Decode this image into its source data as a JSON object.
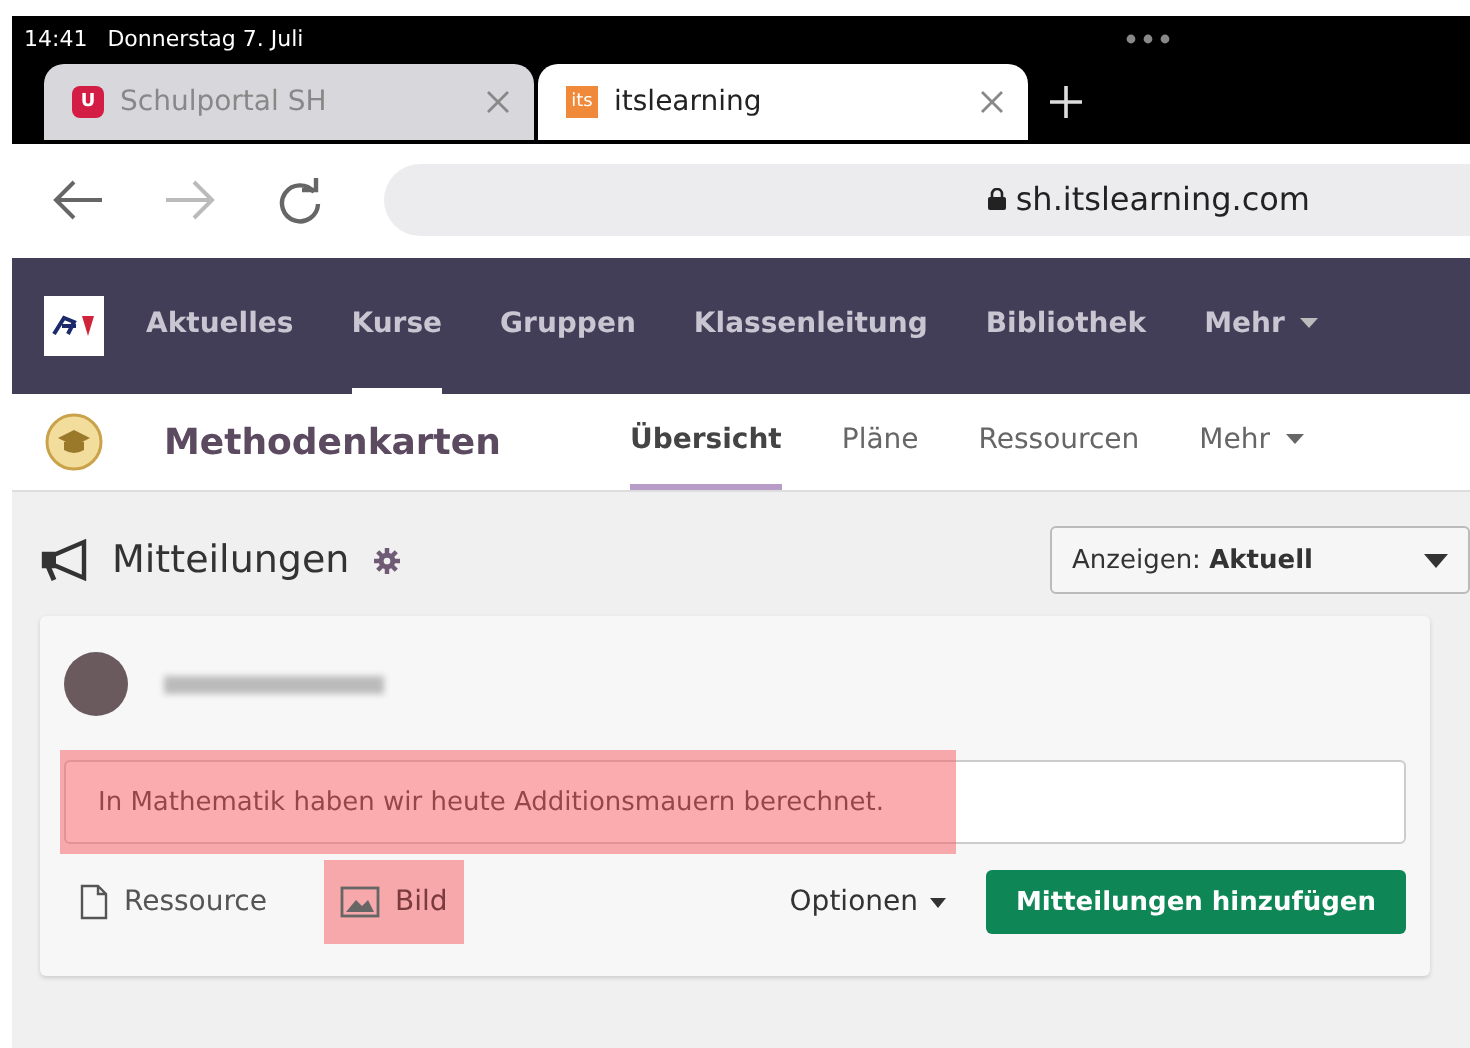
{
  "status_bar": {
    "time": "14:41",
    "date": "Donnerstag 7. Juli"
  },
  "browser_tabs": [
    {
      "title": "Schulportal SH",
      "favicon_text": "U",
      "selected": false
    },
    {
      "title": "itslearning",
      "favicon_text": "its",
      "selected": true
    }
  ],
  "address_bar": {
    "url": "sh.itslearning.com"
  },
  "main_nav": [
    {
      "label": "Aktuelles",
      "selected": false,
      "dropdown": false
    },
    {
      "label": "Kurse",
      "selected": true,
      "dropdown": false
    },
    {
      "label": "Gruppen",
      "selected": false,
      "dropdown": false
    },
    {
      "label": "Klassenleitung",
      "selected": false,
      "dropdown": false
    },
    {
      "label": "Bibliothek",
      "selected": false,
      "dropdown": false
    },
    {
      "label": "Mehr",
      "selected": false,
      "dropdown": true
    }
  ],
  "course": {
    "title": "Methodenkarten",
    "tabs": [
      {
        "label": "Übersicht",
        "selected": true,
        "dropdown": false
      },
      {
        "label": "Pläne",
        "selected": false,
        "dropdown": false
      },
      {
        "label": "Ressourcen",
        "selected": false,
        "dropdown": false
      },
      {
        "label": "Mehr",
        "selected": false,
        "dropdown": true
      }
    ]
  },
  "bulletins": {
    "title": "Mitteilungen",
    "filter": {
      "label": "Anzeigen:",
      "value": "Aktuell"
    },
    "message_field": {
      "value": "In Mathematik haben wir heute Additionsmauern berechnet.",
      "highlighted": true
    },
    "attachments": [
      {
        "kind": "resource",
        "label": "Ressource",
        "highlighted": false
      },
      {
        "kind": "image",
        "label": "Bild",
        "highlighted": true
      }
    ],
    "options": "Optionen",
    "submit": "Mitteilungen hinzufügen"
  }
}
